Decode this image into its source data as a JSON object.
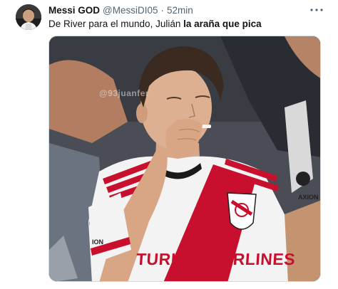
{
  "tweet": {
    "display_name": "Messi GOD",
    "handle": "@MessiDI05",
    "separator": "·",
    "timestamp": "52min",
    "text_plain": "De River para el mundo, Julián ",
    "text_bold": "la araña que pica"
  },
  "media": {
    "watermark": "@93juanfer",
    "shirt_sponsor": "TURKISH AIRLINES",
    "sleeve_left_brand": "ION",
    "sleeve_right_brand": "AXION"
  },
  "icons": {
    "avatar": "avatar-photo",
    "more": "more-options-icon"
  },
  "colors": {
    "text_primary": "#0f1419",
    "text_secondary": "#536471",
    "border": "#cfd9de",
    "river_red": "#c8102e"
  }
}
